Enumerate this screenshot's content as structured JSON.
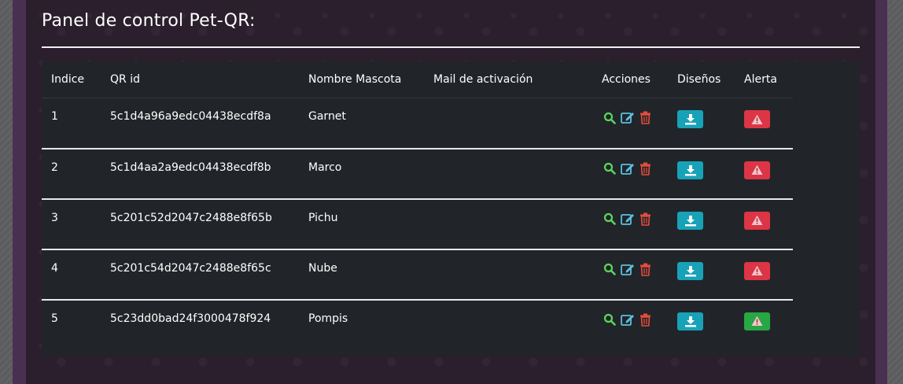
{
  "title": "Panel de control Pet-QR:",
  "table": {
    "headers": {
      "indice": "Indice",
      "qr_id": "QR id",
      "nombre": "Nombre Mascota",
      "mail": "Mail de activación",
      "acciones": "Acciones",
      "disenos": "Diseños",
      "alerta": "Alerta"
    },
    "rows": [
      {
        "indice": "1",
        "qr_id": "5c1d4a96a9edc04438ecdf8a",
        "nombre": "Garnet",
        "mail": "",
        "alert_state": "danger"
      },
      {
        "indice": "2",
        "qr_id": "5c1d4aa2a9edc04438ecdf8b",
        "nombre": "Marco",
        "mail": "",
        "alert_state": "danger"
      },
      {
        "indice": "3",
        "qr_id": "5c201c52d2047c2488e8f65b",
        "nombre": "Pichu",
        "mail": "",
        "alert_state": "danger"
      },
      {
        "indice": "4",
        "qr_id": "5c201c54d2047c2488e8f65c",
        "nombre": "Nube",
        "mail": "",
        "alert_state": "danger"
      },
      {
        "indice": "5",
        "qr_id": "5c23dd0bad24f3000478f924",
        "nombre": "Pompis",
        "mail": "",
        "alert_state": "success"
      }
    ]
  },
  "icons": {
    "view": "search-icon",
    "edit": "edit-icon",
    "delete": "trash-icon",
    "download": "download-icon",
    "alert": "warning-icon"
  },
  "colors": {
    "view": "#5cd65c",
    "edit": "#5bc0de",
    "delete": "#e74c3c",
    "info": "#17a2b8",
    "danger": "#dc3545",
    "success": "#28a745"
  }
}
